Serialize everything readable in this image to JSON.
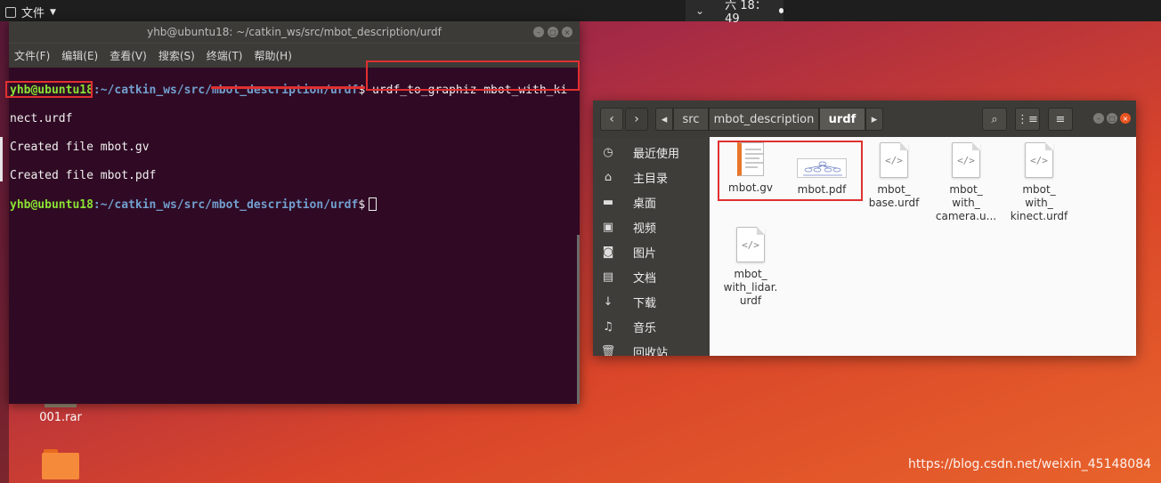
{
  "topbar": {
    "app_menu": "文件",
    "clock": "六 18：49"
  },
  "terminal": {
    "title": "yhb@ubuntu18: ~/catkin_ws/src/mbot_description/urdf",
    "menu": [
      "文件(F)",
      "编辑(E)",
      "查看(V)",
      "搜索(S)",
      "终端(T)",
      "帮助(H)"
    ],
    "prompt_user": "yhb@ubuntu18",
    "prompt_path": ":~/catkin_ws/src/mbot_description/urdf",
    "prompt_symbol": "$",
    "command_part1": " urdf_to_graphiz mbot_with_ki",
    "command_part2": "nect.urdf",
    "output": [
      "Created file mbot.gv",
      "Created file mbot.pdf"
    ]
  },
  "desktop": {
    "icons": [
      {
        "label": "001.rar"
      }
    ]
  },
  "file_manager": {
    "breadcrumbs": [
      "src",
      "mbot_description",
      "urdf"
    ],
    "active_crumb": "urdf",
    "sidebar": [
      {
        "label": "最近使用",
        "icon": "clock-icon"
      },
      {
        "label": "主目录",
        "icon": "home-icon"
      },
      {
        "label": "桌面",
        "icon": "folder-icon"
      },
      {
        "label": "视频",
        "icon": "video-icon"
      },
      {
        "label": "图片",
        "icon": "camera-icon"
      },
      {
        "label": "文档",
        "icon": "document-icon"
      },
      {
        "label": "下载",
        "icon": "download-icon"
      },
      {
        "label": "音乐",
        "icon": "music-icon"
      },
      {
        "label": "回收站",
        "icon": "trash-icon"
      }
    ],
    "files": [
      {
        "name": "mbot.gv",
        "type": "gv"
      },
      {
        "name": "mbot.pdf",
        "type": "pdf"
      },
      {
        "name": "mbot_\nbase.urdf",
        "type": "urdf"
      },
      {
        "name": "mbot_\nwith_\ncamera.u...",
        "type": "urdf"
      },
      {
        "name": "mbot_\nwith_\nkinect.urdf",
        "type": "urdf"
      },
      {
        "name": "mbot_\nwith_lidar.\nurdf",
        "type": "urdf"
      }
    ]
  },
  "watermark": "https://blog.csdn.net/weixin_45148084",
  "colors": {
    "terminal_bg": "#300a24",
    "highlight": "#e03030",
    "accent": "#e95420"
  }
}
